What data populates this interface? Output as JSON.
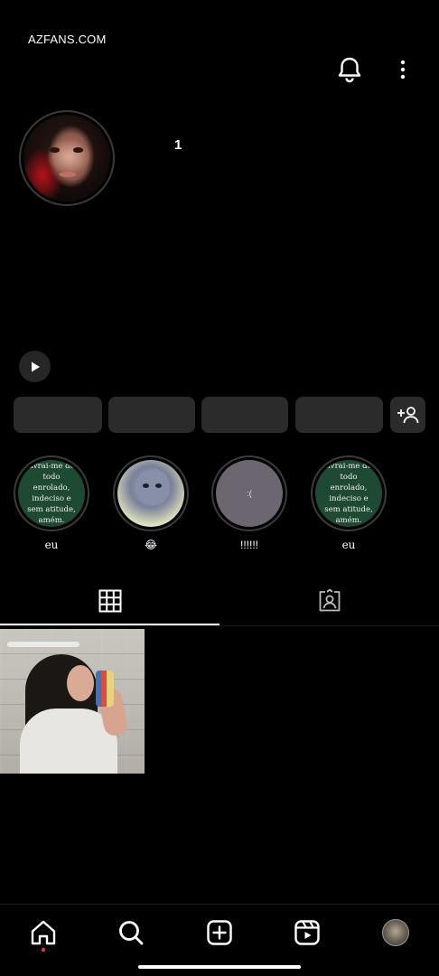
{
  "watermark": "AZFANS.COM",
  "header": {
    "notifications_icon": "bell-icon",
    "menu_icon": "vertical-dots-icon"
  },
  "profile": {
    "post_count": "1"
  },
  "actions": {
    "add_friend_icon": "person-plus-icon"
  },
  "highlights": [
    {
      "label": "eu",
      "cover_text": "livrai-me de todo enrolado, indeciso e sem atitude, amém."
    },
    {
      "label": "😂",
      "cover_text": ""
    },
    {
      "label": "!!!!!!",
      "cover_text": ":("
    },
    {
      "label": "eu",
      "cover_text": "livrai-me de todo enrolado, indeciso e sem atitude, amém."
    }
  ],
  "tabs": [
    {
      "name": "posts-grid",
      "icon": "grid-icon"
    },
    {
      "name": "tagged",
      "icon": "tagged-person-icon"
    }
  ],
  "nav": [
    {
      "name": "home",
      "icon": "home-icon"
    },
    {
      "name": "search",
      "icon": "search-icon"
    },
    {
      "name": "create",
      "icon": "plus-square-icon"
    },
    {
      "name": "reels",
      "icon": "reels-icon"
    },
    {
      "name": "profile",
      "icon": "avatar"
    }
  ],
  "colors": {
    "background": "#000000",
    "button": "#2b2b2b",
    "highlight_green": "#1e4a34",
    "notification_dot": "#ff3040"
  }
}
